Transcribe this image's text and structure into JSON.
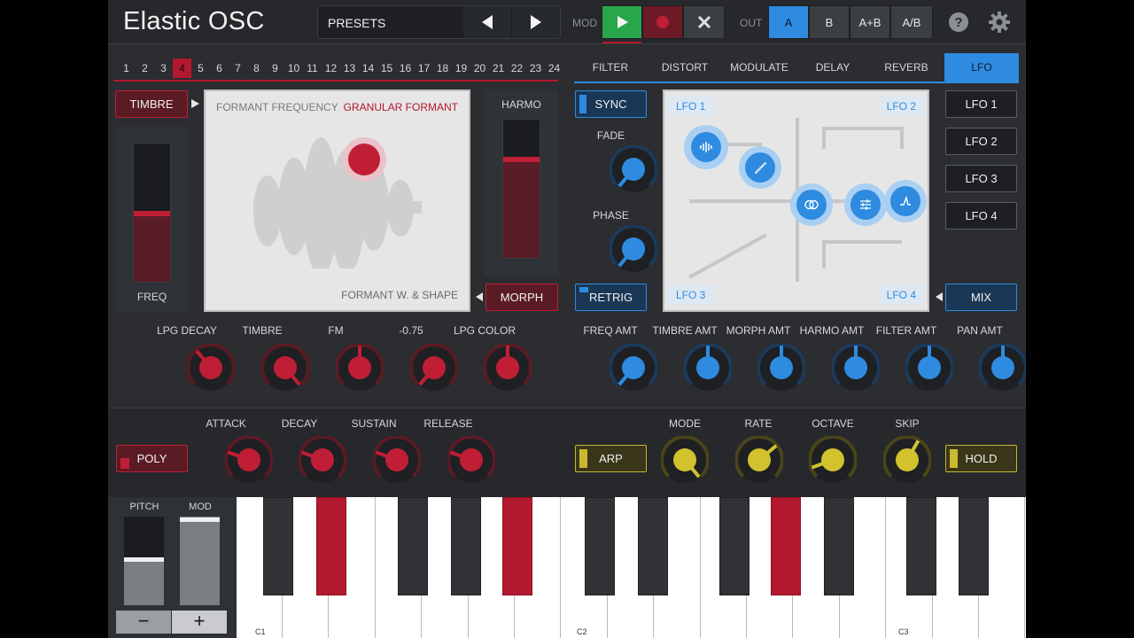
{
  "header": {
    "app_title": "Elastic OSC",
    "presets_label": "PRESETS",
    "mod_label": "MOD",
    "out_label": "OUT",
    "out_options": [
      "A",
      "B",
      "A+B",
      "A/B"
    ],
    "out_selected": "A"
  },
  "steps": {
    "numbers": [
      "1",
      "2",
      "3",
      "4",
      "5",
      "6",
      "7",
      "8",
      "9",
      "10",
      "11",
      "12",
      "13",
      "14",
      "15",
      "16",
      "17",
      "18",
      "19",
      "20",
      "21",
      "22",
      "23",
      "24"
    ],
    "active": "4"
  },
  "tabs": {
    "items": [
      "FILTER",
      "DISTORT",
      "MODULATE",
      "DELAY",
      "REVERB",
      "LFO"
    ],
    "active": "LFO"
  },
  "osc": {
    "timbre_button": "TIMBRE",
    "freq_label": "FREQ",
    "pad_top_left": "FORMANT FREQUENCY",
    "pad_top_right": "GRANULAR FORMANT",
    "pad_bottom_right": "FORMANT W. & SHAPE",
    "harmo_label": "HARMO",
    "morph_button": "MORPH",
    "freq_level": 0.5,
    "harmo_level": 0.7
  },
  "lfo": {
    "sync_button": "SYNC",
    "fade_label": "FADE",
    "phase_label": "PHASE",
    "retrig_button": "RETRIG",
    "corner_labels": [
      "LFO 1",
      "LFO 2",
      "LFO 3",
      "LFO 4"
    ],
    "side_buttons": [
      "LFO 1",
      "LFO 2",
      "LFO 3",
      "LFO 4"
    ],
    "mix_button": "MIX"
  },
  "red_knobs": [
    "LPG DECAY",
    "TIMBRE",
    "FM",
    "-0.75",
    "LPG COLOR"
  ],
  "blue_knobs": [
    "FREQ AMT",
    "TIMBRE AMT",
    "MORPH AMT",
    "HARMO AMT",
    "FILTER AMT",
    "PAN AMT"
  ],
  "envelope": {
    "labels": [
      "ATTACK",
      "DECAY",
      "SUSTAIN",
      "RELEASE"
    ],
    "poly_button": "POLY"
  },
  "arp": {
    "arp_button": "ARP",
    "labels": [
      "MODE",
      "RATE",
      "OCTAVE",
      "SKIP"
    ],
    "hold_button": "HOLD"
  },
  "wheels": {
    "pitch_label": "PITCH",
    "mod_label": "MOD",
    "minus": "−",
    "plus": "+"
  },
  "keyboard": {
    "octave_labels": [
      "C1",
      "C2",
      "C3"
    ]
  },
  "colors": {
    "accent_red": "#b3182e",
    "accent_blue": "#2e8be0",
    "accent_yellow": "#c9b92e",
    "play_green": "#27a74a"
  }
}
